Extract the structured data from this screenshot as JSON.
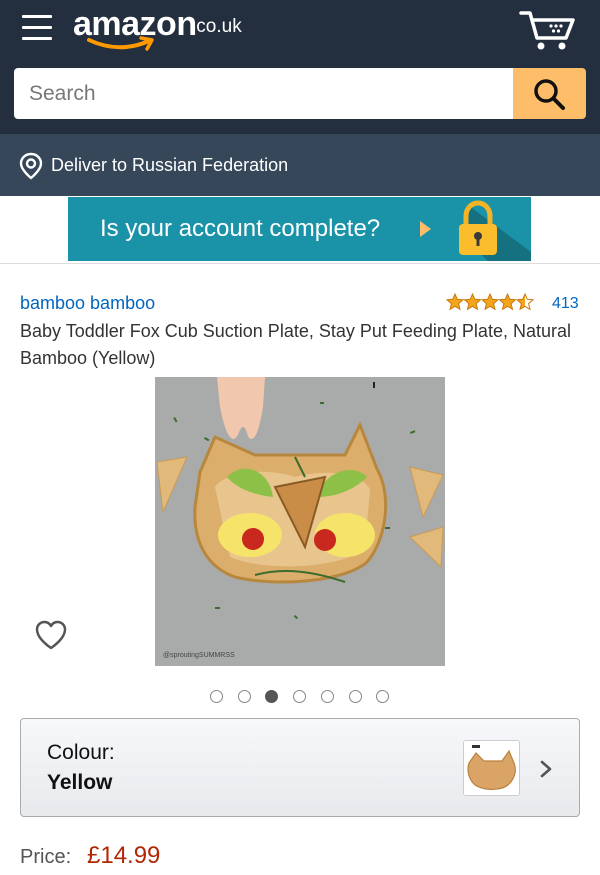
{
  "header": {
    "logo_text": "amazon",
    "logo_tld": ".co.uk",
    "menu_icon": "hamburger-menu-icon",
    "cart_icon": "cart-icon"
  },
  "search": {
    "placeholder": "Search",
    "value": "",
    "button_icon": "search-icon"
  },
  "delivery": {
    "icon": "location-pin-icon",
    "text": "Deliver to Russian Federation"
  },
  "banner": {
    "text": "Is your account complete?",
    "icon": "padlock-icon"
  },
  "product": {
    "brand": "bamboo bamboo",
    "rating": 4.5,
    "rating_max": 5,
    "review_count": "413",
    "title": "Baby Toddler Fox Cub Suction Plate, Stay Put Feeding Plate, Natural Bamboo (Yellow)",
    "image_watermark": "@sproutingSUMMRSS",
    "images_total": 7,
    "current_image": 3
  },
  "colour_selector": {
    "label": "Colour:",
    "value": "Yellow",
    "chevron_icon": "chevron-right-icon"
  },
  "price": {
    "label": "Price:",
    "value": "£14.99"
  },
  "colors": {
    "nav_dark": "#232f3e",
    "nav_sub": "#37475a",
    "accent_orange": "#febd69",
    "link_blue": "#0066c0",
    "price_red": "#b12704",
    "banner_teal": "#1a93a8",
    "star_gold": "#f4a41d"
  }
}
